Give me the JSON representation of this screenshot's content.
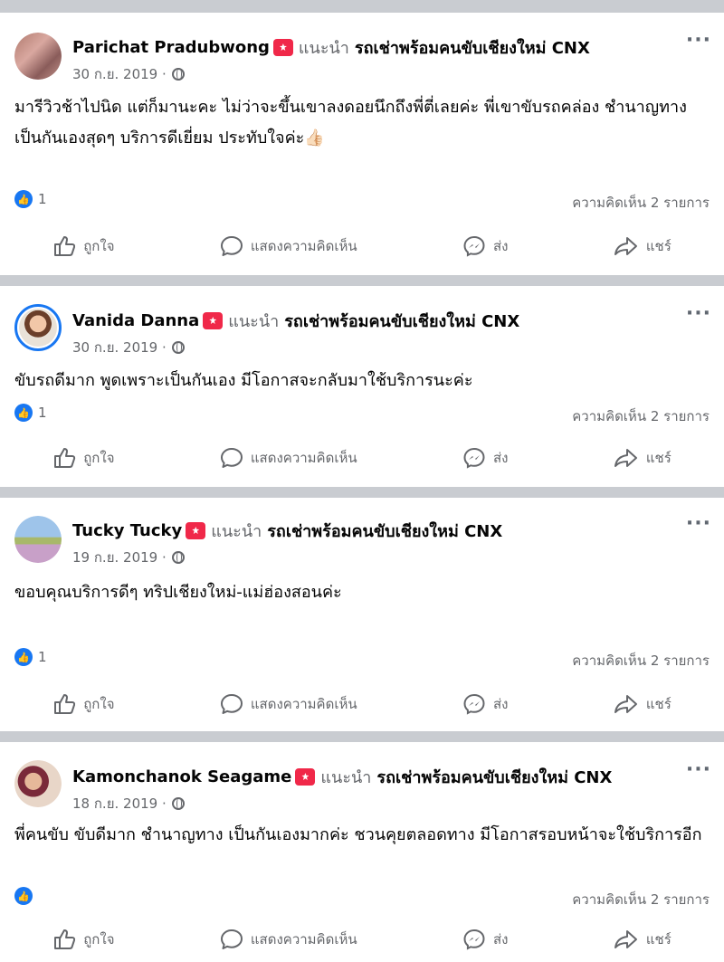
{
  "colors": {
    "accent": "#1877f2",
    "recommend": "#f02849",
    "muted": "#65676b",
    "separator": "#c9ccd1"
  },
  "posts": [
    {
      "author": "Parichat Pradubwong",
      "recommends": "แนะนำ",
      "page": "รถเช่าพร้อมคนขับเชียงใหม่ CNX",
      "date": "30 ก.ย. 2019 ·",
      "text": "มารีวิวช้าไปนิด แต่ก็มานะคะ ไม่ว่าจะขึ้นเขาลงดอยนึกถึงพี่ตี่เลยค่ะ พี่เขาขับรถคล่อง ชำนาญทางเป็นกันเองสุดๆ บริการดีเยี่ยม ประทับใจค่ะ👍🏻",
      "reaction_count": "1",
      "comments": "ความคิดเห็น 2 รายการ"
    },
    {
      "author": "Vanida Danna",
      "recommends": "แนะนำ",
      "page": "รถเช่าพร้อมคนขับเชียงใหม่ CNX",
      "date": "30 ก.ย. 2019 ·",
      "text": "ขับรถดีมาก พูดเพราะเป็นกันเอง มีโอกาสจะกลับมาใช้บริการนะค่ะ",
      "reaction_count": "1",
      "comments": "ความคิดเห็น 2 รายการ"
    },
    {
      "author": "Tucky Tucky",
      "recommends": "แนะนำ",
      "page": "รถเช่าพร้อมคนขับเชียงใหม่ CNX",
      "date": "19 ก.ย. 2019 ·",
      "text": "ขอบคุณบริการดีๆ ทริปเชียงใหม่-แม่ฮ่องสอนค่ะ",
      "reaction_count": "1",
      "comments": "ความคิดเห็น 2 รายการ"
    },
    {
      "author": "Kamonchanok Seagame",
      "recommends": "แนะนำ",
      "page": "รถเช่าพร้อมคนขับเชียงใหม่ CNX",
      "date": "18 ก.ย. 2019 ·",
      "text": "พี่คนขับ ขับดีมาก ชำนาญทาง เป็นกันเองมากค่ะ ชวนคุยตลอดทาง มีโอกาสรอบหน้าจะใช้บริการอีก",
      "reaction_count": "",
      "comments": "ความคิดเห็น 2 รายการ"
    }
  ],
  "actions": {
    "like": "ถูกใจ",
    "comment": "แสดงความคิดเห็น",
    "send": "ส่ง",
    "share": "แชร์"
  },
  "more": "···"
}
